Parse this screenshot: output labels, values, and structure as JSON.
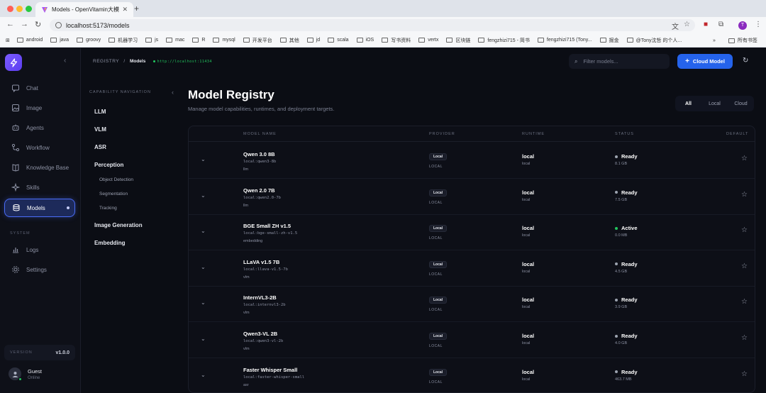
{
  "browser": {
    "tab_title": "Models - OpenVitamin大模型",
    "url": "localhost:5173/models",
    "profile_initial": "T",
    "bookmarks": [
      "android",
      "java",
      "groovy",
      "机器学习",
      "js",
      "mac",
      "R",
      "mysql",
      "开发平台",
      "其他",
      "jd",
      "scala",
      "iOS",
      "写书资料",
      "vertx",
      "区块链",
      "fengzhizi715 - 简书",
      "fengzhizi715 (Tony...",
      "掘金",
      "@Tony沈哲 的个人..."
    ],
    "bookmarks_more": "»",
    "all_bookmarks": "所有书签"
  },
  "sidebar": {
    "items": [
      {
        "label": "Chat",
        "icon": "chat-icon"
      },
      {
        "label": "Image",
        "icon": "image-icon"
      },
      {
        "label": "Agents",
        "icon": "agents-icon"
      },
      {
        "label": "Workflow",
        "icon": "workflow-icon"
      },
      {
        "label": "Knowledge Base",
        "icon": "book-icon"
      },
      {
        "label": "Skills",
        "icon": "sparkle-icon"
      },
      {
        "label": "Models",
        "icon": "database-icon",
        "active": true
      }
    ],
    "system_label": "SYSTEM",
    "system_items": [
      {
        "label": "Logs",
        "icon": "chart-icon"
      },
      {
        "label": "Settings",
        "icon": "gear-icon"
      }
    ],
    "version_label": "VERSION",
    "version_value": "v1.0.0",
    "user_name": "Guest",
    "user_status": "Online"
  },
  "capability_nav": {
    "title": "CAPABILITY NAVIGATION",
    "items": [
      "LLM",
      "VLM",
      "ASR",
      "Perception"
    ],
    "perception_sub": [
      "Object Detection",
      "Segmentation",
      "Tracking"
    ],
    "items_after": [
      "Image Generation",
      "Embedding"
    ]
  },
  "header": {
    "crumb_root": "REGISTRY",
    "crumb_sep": "/",
    "crumb_current": "Models",
    "host": "http://localhost:11434",
    "search_placeholder": "Filter models...",
    "cloud_button": "Cloud Model"
  },
  "main": {
    "title": "Model Registry",
    "subtitle": "Manage model capabilities, runtimes, and deployment targets.",
    "filters": [
      "All",
      "Local",
      "Cloud"
    ],
    "selected_filter": "All",
    "columns": [
      "MODEL NAME",
      "PROVIDER",
      "RUNTIME",
      "STATUS",
      "DEFAULT"
    ],
    "rows": [
      {
        "name": "Qwen 3.0 8B",
        "id": "local:qwen3-8b",
        "cap": "llm",
        "badge": "Local",
        "provider": "LOCAL",
        "runtime": "local",
        "runtime_sub": "local",
        "status": "Ready",
        "status_color": "#9ca3af",
        "size": "8.1 GB"
      },
      {
        "name": "Qwen 2.0 7B",
        "id": "local:qwen2.0-7b",
        "cap": "llm",
        "badge": "Local",
        "provider": "LOCAL",
        "runtime": "local",
        "runtime_sub": "local",
        "status": "Ready",
        "status_color": "#9ca3af",
        "size": "7.5 GB"
      },
      {
        "name": "BGE Small ZH v1.5",
        "id": "local:bge-small-zh-v1.5",
        "cap": "embedding",
        "badge": "Local",
        "provider": "LOCAL",
        "runtime": "local",
        "runtime_sub": "local",
        "status": "Active",
        "status_color": "#22c55e",
        "size": "0.0 MB"
      },
      {
        "name": "LLaVA v1.5 7B",
        "id": "local:llava-v1.5-7b",
        "cap": "vlm",
        "badge": "Local",
        "provider": "LOCAL",
        "runtime": "local",
        "runtime_sub": "local",
        "status": "Ready",
        "status_color": "#9ca3af",
        "size": "4.5 GB"
      },
      {
        "name": "InternVL3-2B",
        "id": "local:internvl3-2b",
        "cap": "vlm",
        "badge": "Local",
        "provider": "LOCAL",
        "runtime": "local",
        "runtime_sub": "local",
        "status": "Ready",
        "status_color": "#9ca3af",
        "size": "3.9 GB"
      },
      {
        "name": "Qwen3-VL 2B",
        "id": "local:qwen3-vl-2b",
        "cap": "vlm",
        "badge": "Local",
        "provider": "LOCAL",
        "runtime": "local",
        "runtime_sub": "local",
        "status": "Ready",
        "status_color": "#9ca3af",
        "size": "4.0 GB"
      },
      {
        "name": "Faster Whisper Small",
        "id": "local:faster-whisper-small",
        "cap": "asr",
        "badge": "Local",
        "provider": "LOCAL",
        "runtime": "local",
        "runtime_sub": "local",
        "status": "Ready",
        "status_color": "#9ca3af",
        "size": "463.7 MB"
      }
    ]
  }
}
